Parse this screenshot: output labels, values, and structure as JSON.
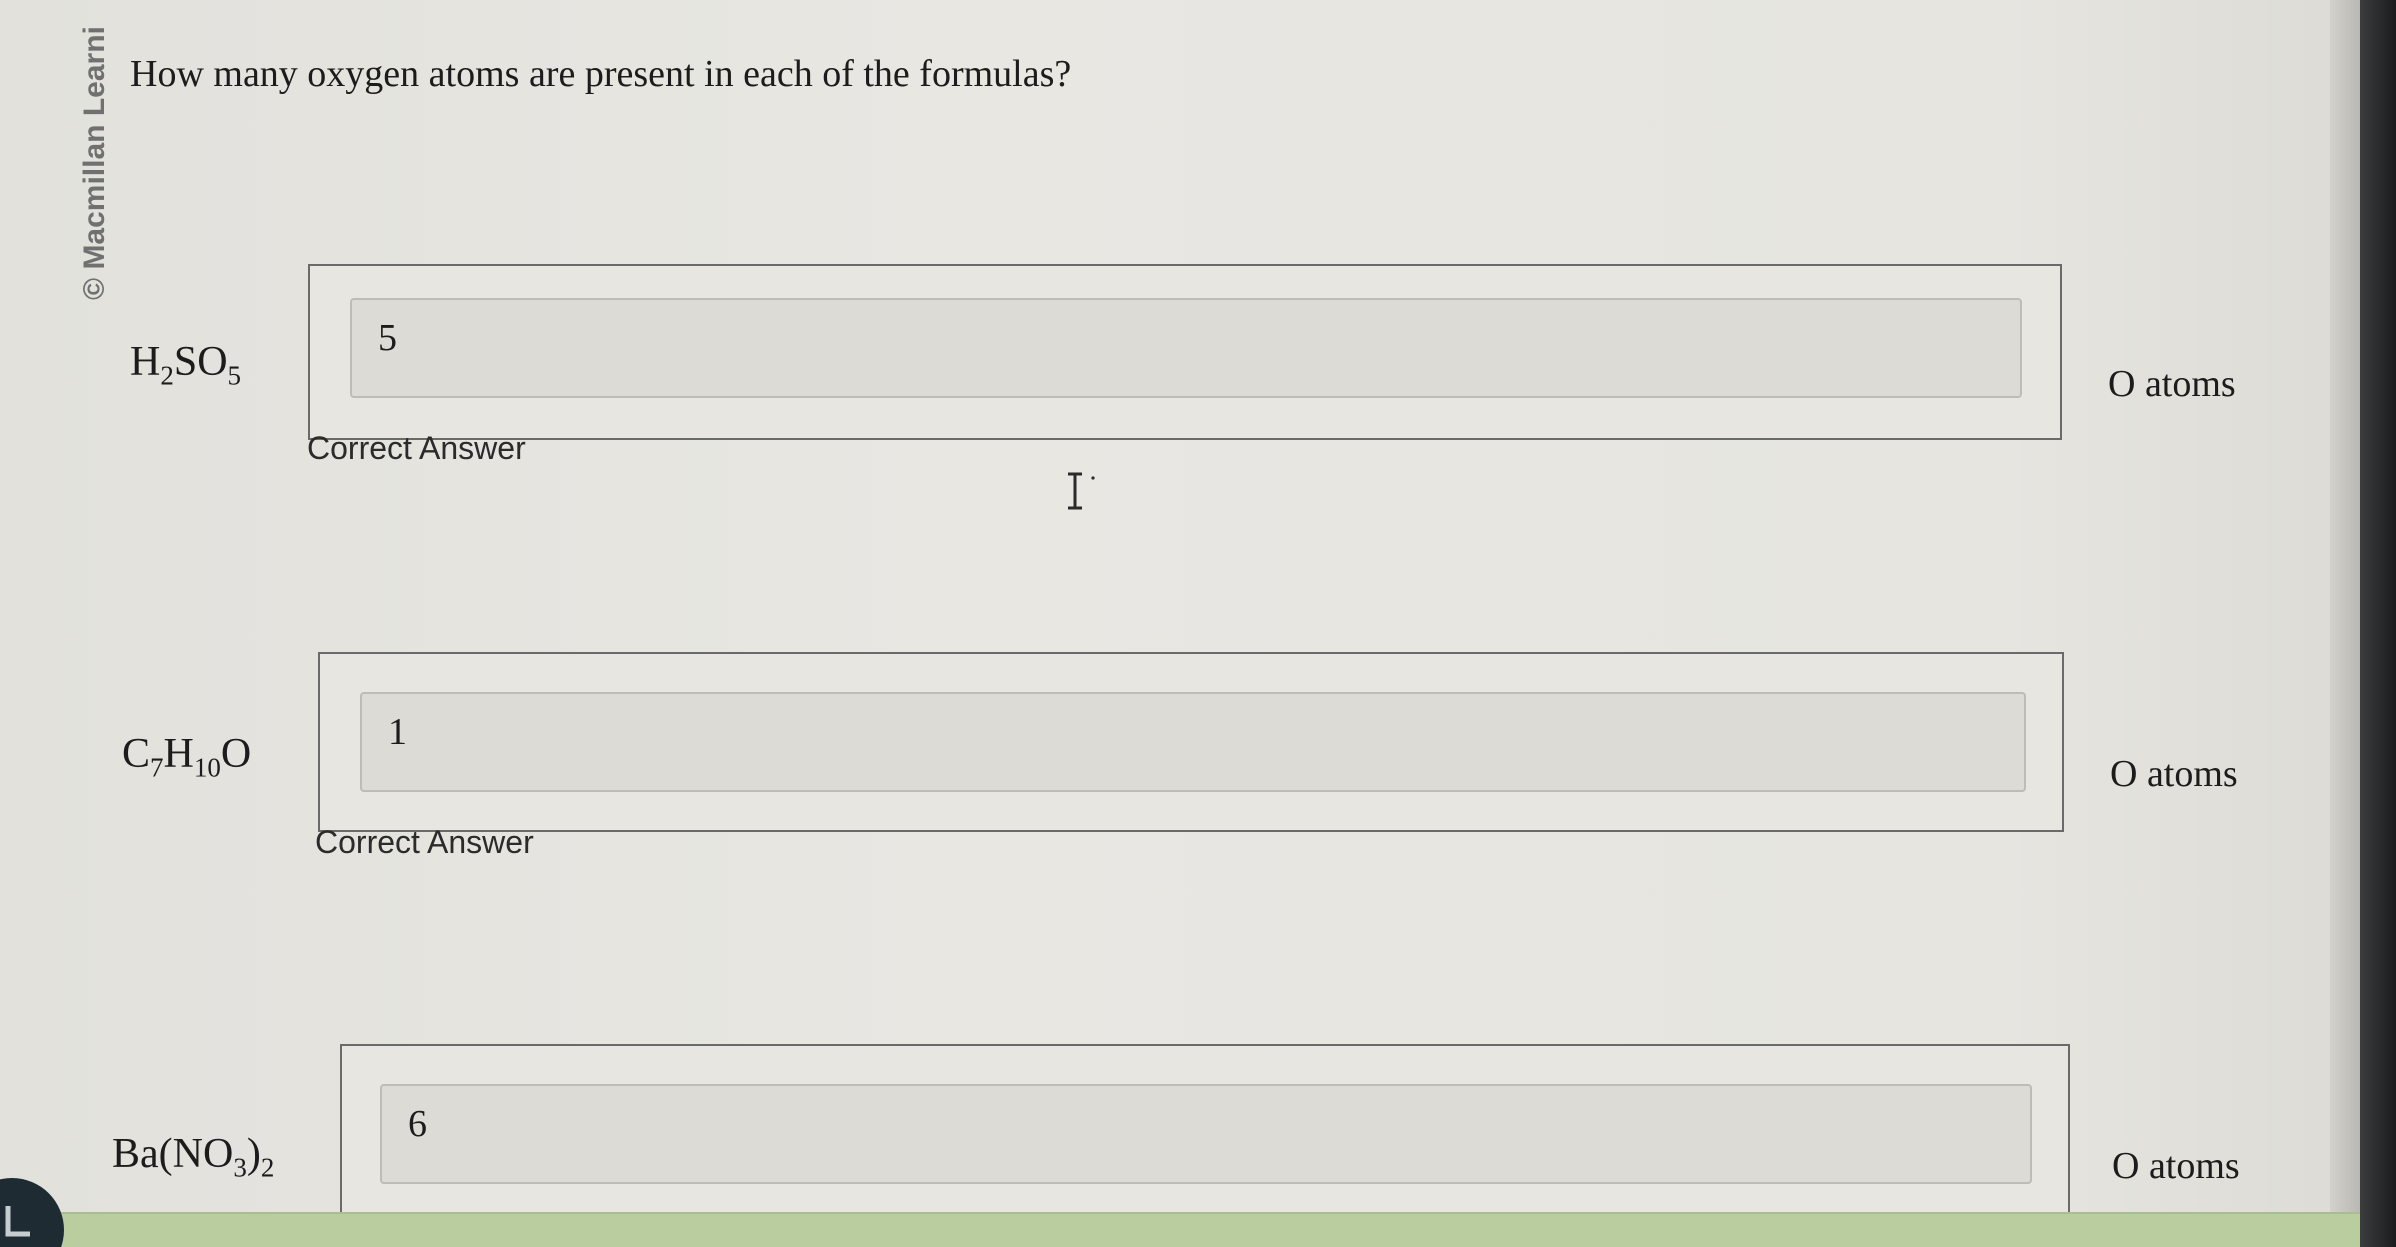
{
  "copyright": "© Macmillan Learni",
  "question": "How many oxygen atoms are present in each of the formulas?",
  "items": [
    {
      "formula": [
        {
          "t": "H"
        },
        {
          "s": "2"
        },
        {
          "t": "SO"
        },
        {
          "s": "5"
        }
      ],
      "answer": "5",
      "status": "Correct Answer",
      "unit": "O atoms"
    },
    {
      "formula": [
        {
          "t": "C"
        },
        {
          "s": "7"
        },
        {
          "t": "H"
        },
        {
          "s": "10"
        },
        {
          "t": "O"
        }
      ],
      "answer": "1",
      "status": "Correct Answer",
      "unit": "O atoms"
    },
    {
      "formula": [
        {
          "t": "Ba(NO"
        },
        {
          "s": "3"
        },
        {
          "t": ")"
        },
        {
          "s": "2"
        }
      ],
      "answer": "6",
      "status": "",
      "unit": "O atoms"
    }
  ],
  "icons": {
    "cursor": "text-cursor-icon",
    "corner": "arrow-icon"
  }
}
